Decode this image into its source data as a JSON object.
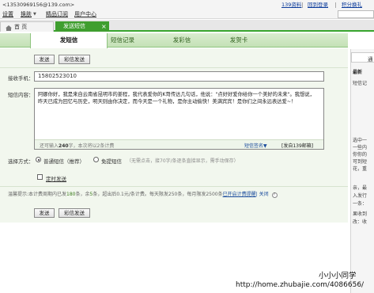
{
  "top": {
    "email": "<13530969156@139.com>",
    "links": [
      "139资料",
      "回到登录",
      "积分换礼"
    ]
  },
  "nav": {
    "items": [
      "设置",
      "换肤",
      "精品订阅",
      "用户中心"
    ],
    "skin_arrow": "▼"
  },
  "page_tabs": [
    {
      "label": "首 页"
    },
    {
      "label": "发送短信",
      "close": "×"
    }
  ],
  "sub_tabs": [
    "发短信",
    "短信记录",
    "发彩信",
    "发贺卡"
  ],
  "buttons": {
    "send": "发送",
    "send_mms": "彩信发送"
  },
  "form": {
    "recipient_label": "接收手机：",
    "recipient_value": "15802523010",
    "content_label": "短信内容：",
    "message": "阿娜你好，我是来自云南省昆明市的姜程，我代表爱你的K哥传达几句话，他说：\"点好好爱你给你一个美好的未来\"。我想说，昨天已成为回忆与历史，明天则由你决定，而今天是一个礼物，是你主动偷快！美满宾宾！是你们之间永远表达爱~！",
    "count_hint": "还可输入",
    "count_num": "240",
    "count_tail": "字，本次将以2条计费",
    "signature_link": "短信签名▼",
    "sign_tag": "[发自139邮箱]",
    "mode_label": "选择方式：",
    "mode_normal": "普通短信（推荐）",
    "mode_free": "免提短信",
    "mode_free_desc": "（无需点击，接70字/条逐条直接显示，需手动保存）",
    "schedule_label": "定时发送",
    "tip_prefix": "温馨提示:本计费周期内已发",
    "tip_sent": "180",
    "tip_mid1": "条，余",
    "tip_left": "5",
    "tip_mid2": "条，超出后0.1元/条计费。每天限发250条，每月限发2500条",
    "tip_link": "已开启计费提醒",
    "tip_sep": "| 关闭",
    "help": "?"
  },
  "right_panel": {
    "tab": "通",
    "lines": [
      "最新",
      "短信记",
      "选中一",
      "一些内",
      "你你的",
      "可到短",
      "花，重",
      "亲，最",
      "入发行",
      "一条：",
      "果收到",
      "改：收"
    ]
  },
  "watermark": {
    "name": "小小小同学",
    "url": "http://home.zhubajie.com/4086656/"
  }
}
